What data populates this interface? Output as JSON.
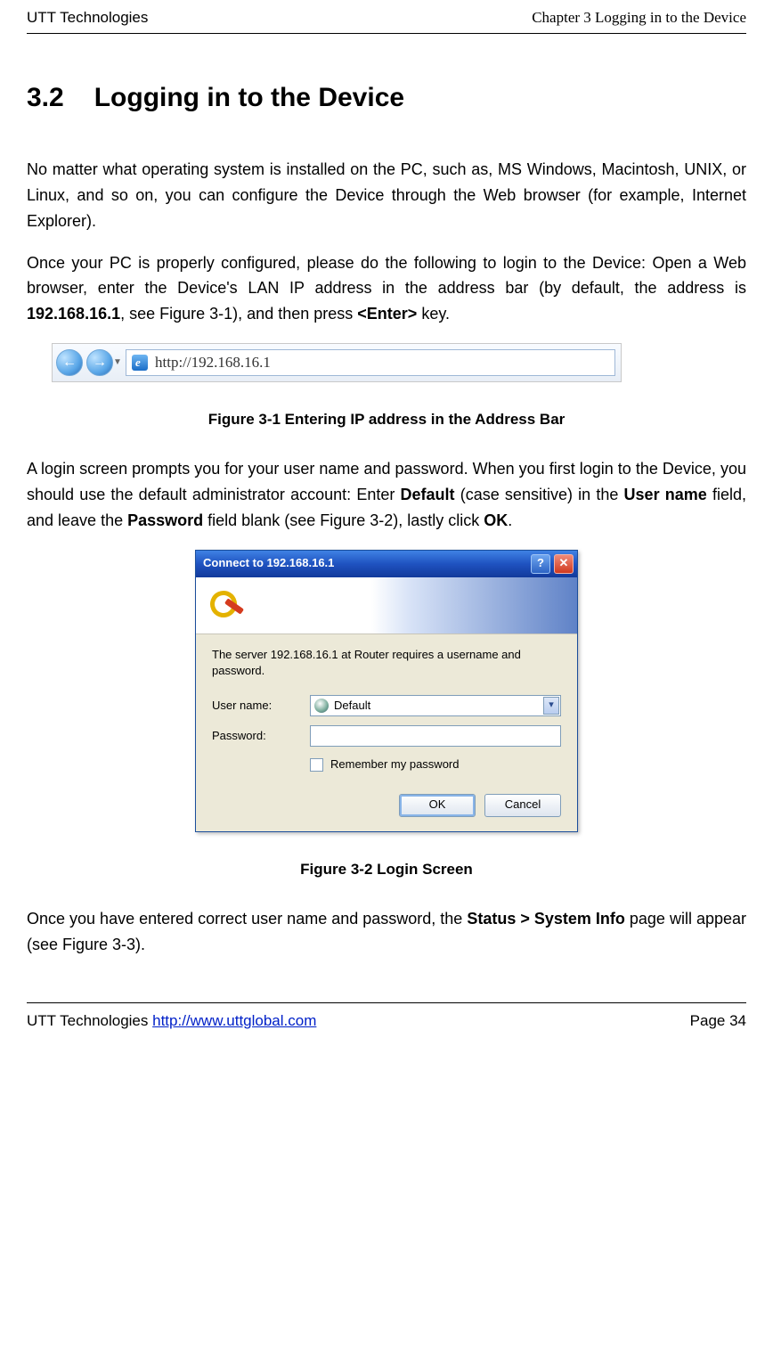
{
  "header": {
    "left": "UTT Technologies",
    "right": "Chapter 3 Logging in to the Device"
  },
  "section": {
    "number": "3.2",
    "title": "Logging in to the Device"
  },
  "para1_a": "No matter what operating system is installed on the PC, such as, MS Windows, Macintosh, UNIX, or Linux, and so on, you can configure the Device through the Web browser (for example, Internet Explorer).",
  "para2_a": "Once your PC is properly configured, please do the following to login to the Device: Open a Web browser, enter the Device's LAN IP address in the address bar (by default, the address is ",
  "para2_ip": "192.168.16.1",
  "para2_b": ", see Figure 3-1), and then press ",
  "para2_key": "<Enter>",
  "para2_c": " key.",
  "address_bar": {
    "url": "http://192.168.16.1"
  },
  "fig1_caption": "Figure 3-1 Entering IP address in the Address Bar",
  "para3_a": "A login screen prompts you for your user name and password. When you first login to the Device, you should use the default administrator account: Enter ",
  "para3_default": "Default",
  "para3_b": " (case sensitive) in the ",
  "para3_user": "User name",
  "para3_c": " field, and leave the ",
  "para3_pass": "Password",
  "para3_d": " field blank (see Figure 3-2), lastly click ",
  "para3_ok": "OK",
  "para3_e": ".",
  "dialog": {
    "title": "Connect to 192.168.16.1",
    "message": "The server 192.168.16.1 at Router requires a username and password.",
    "user_label": "User name:",
    "pass_label": "Password:",
    "user_value": "Default",
    "remember_label": "Remember my password",
    "ok": "OK",
    "cancel": "Cancel"
  },
  "fig2_caption": "Figure 3-2 Login Screen",
  "para4_a": "Once you have entered correct user name and password, the ",
  "para4_b": "Status > System Info",
  "para4_c": " page will appear (see Figure 3-3).",
  "footer": {
    "left_a": "UTT Technologies ",
    "left_link": "http://www.uttglobal.com",
    "right": "Page 34"
  }
}
